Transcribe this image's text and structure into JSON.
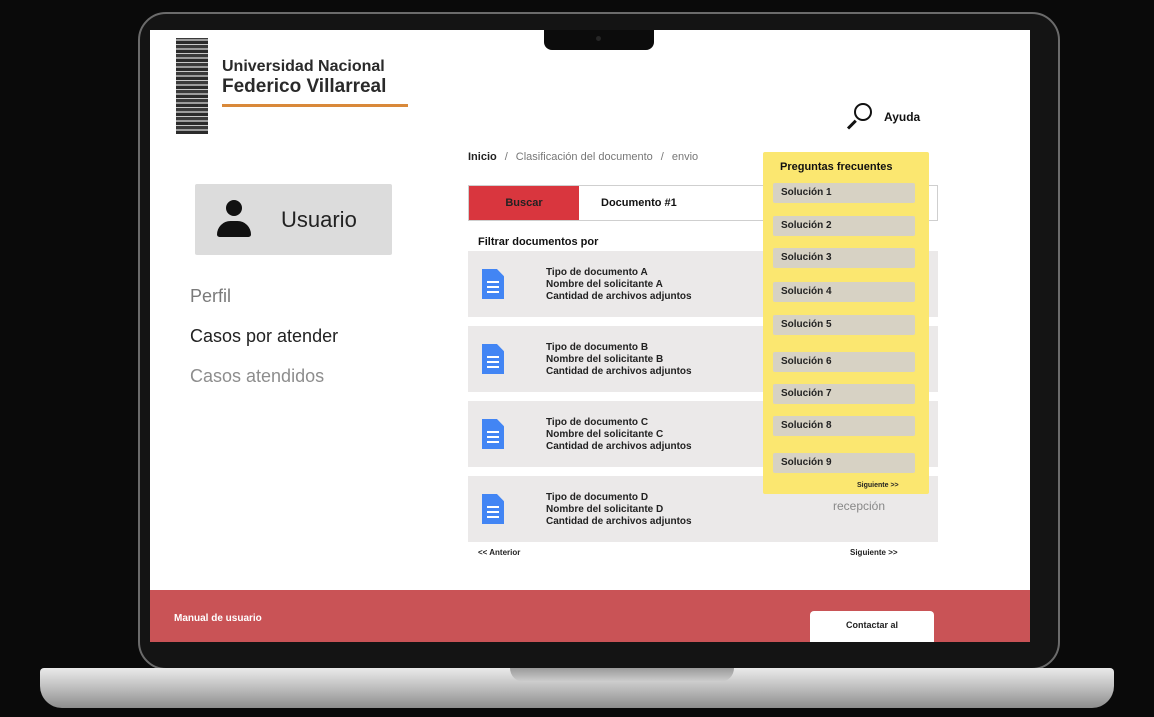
{
  "header": {
    "university_line1": "Universidad Nacional",
    "university_line2": "Federico Villarreal",
    "help_label": "Ayuda",
    "help_icon": "search-icon"
  },
  "breadcrumb": {
    "home": "Inicio",
    "separator": "/",
    "step2": "Clasificación del documento",
    "step3": "envio"
  },
  "sidebar": {
    "user_label": "Usuario",
    "items": [
      {
        "label": "Perfil"
      },
      {
        "label": "Casos por atender"
      },
      {
        "label": "Casos atendidos"
      }
    ]
  },
  "search": {
    "button_label": "Buscar",
    "value": "Documento #1"
  },
  "filter_label": "Filtrar documentos por",
  "documents": [
    {
      "type": "Tipo de documento A",
      "applicant": "Nombre del solicitante A",
      "attachments": "Cantidad de archivos adjuntos"
    },
    {
      "type": "Tipo de documento B",
      "applicant": "Nombre del solicitante B",
      "attachments": "Cantidad de archivos adjuntos"
    },
    {
      "type": "Tipo de documento C",
      "applicant": "Nombre del solicitante C",
      "attachments": "Cantidad de archivos adjuntos"
    },
    {
      "type": "Tipo de documento D",
      "applicant": "Nombre del solicitante D",
      "attachments": "Cantidad de archivos adjuntos",
      "extra": "recepción"
    }
  ],
  "pagination": {
    "prev": "<< Anterior",
    "next": "Siguiente >>"
  },
  "faq": {
    "title": "Preguntas frecuentes",
    "items": [
      "Solución 1",
      "Solución 2",
      "Solución 3",
      "Solución 4",
      "Solución 5",
      "Solución 6",
      "Solución 7",
      "Solución 8",
      "Solución 9"
    ],
    "next": "Siguiente >>"
  },
  "footer": {
    "manual": "Manual de usuario",
    "contact": "Contactar al"
  },
  "colors": {
    "accent_red": "#d9363e",
    "footer_red": "#c95356",
    "faq_yellow": "#fbe770",
    "underline_orange": "#d9893a",
    "doc_blue": "#4285f4"
  }
}
